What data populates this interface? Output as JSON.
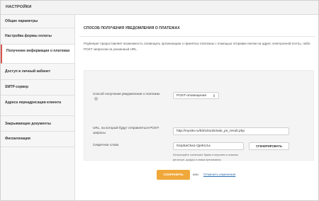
{
  "header": {
    "title": "НАСТРОЙКИ"
  },
  "sidebar": {
    "items": [
      {
        "label": "Общие параметры"
      },
      {
        "label": "Настройка формы оплаты"
      },
      {
        "label": "Получение информации о платежах",
        "active": true
      },
      {
        "label": "Доступ в личный кабинет"
      },
      {
        "label": "SMTP-сервер"
      },
      {
        "label": "Адреса переадресации клиента"
      },
      {
        "label": "Закрывающие документы"
      },
      {
        "label": "Фискализация"
      }
    ]
  },
  "main": {
    "heading": "СПОСОБ ПОЛУЧЕНИЯ УВЕДОМЛЕНИЯ О ПЛАТЕЖАХ",
    "description": "Paykeeper предоставляет возможность оповещать организацию о принятых платежах с помощью отправки писем на адрес электронной почты, либо POST запросом на указанный URL.",
    "method_label": "Способ получения уведомления о платежах",
    "help_icon": "?",
    "method_value": "POST-оповещения",
    "url_label": "URL, на который будут отправляться POST-запросы",
    "url_value": "http://mysite.ru/bitrix/tools/sale_ps_result.php",
    "secret_label": "Секретное слово",
    "secret_value": "N1ip5aC5a1-QpiKU1a",
    "generate_label": "СГЕНЕРИРОВАТЬ",
    "hint": "Используйте латинские буквы в верхнем и нижнем регистре, цифры и знаки препинания",
    "save_label": "СОХРАНИТЬ",
    "or_text": "или",
    "cancel_label": "Отменить изменения"
  },
  "colors": {
    "accent": "#f0a83a",
    "active_marker": "#d9534f",
    "link": "#2b6cb0"
  }
}
